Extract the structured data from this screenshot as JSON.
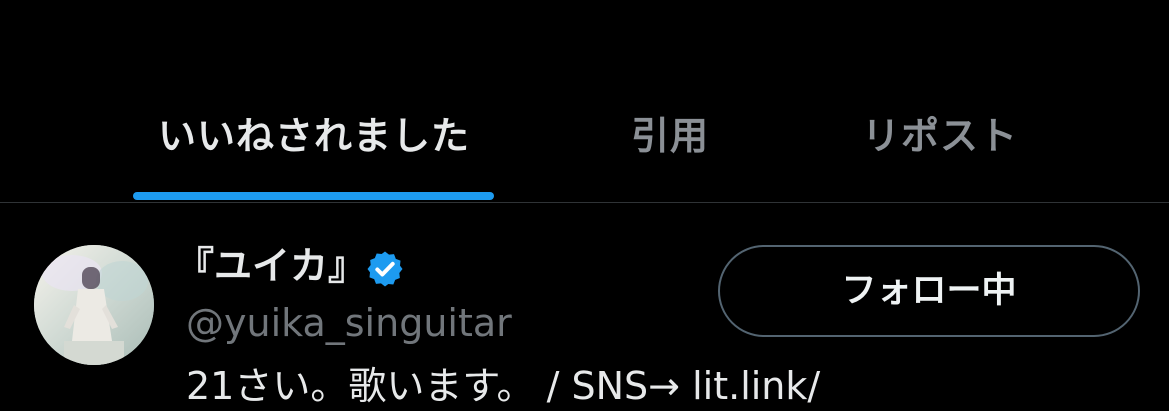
{
  "tabs": [
    {
      "label": "いいねされました",
      "active": true
    },
    {
      "label": "引用",
      "active": false
    },
    {
      "label": "リポスト",
      "active": false
    }
  ],
  "colors": {
    "accent": "#1d9bf0",
    "background": "#000000",
    "text_primary": "#e7e9ea",
    "text_secondary": "#71767b",
    "divider": "#2f3336",
    "button_border": "#536471"
  },
  "user": {
    "display_name": "『ユイカ』",
    "handle": "@yuika_singuitar",
    "verified_icon": "verified-badge-icon",
    "follow_button_label": "フォロー中",
    "bio": "21さい。歌います。 / SNS→ lit.link/"
  }
}
